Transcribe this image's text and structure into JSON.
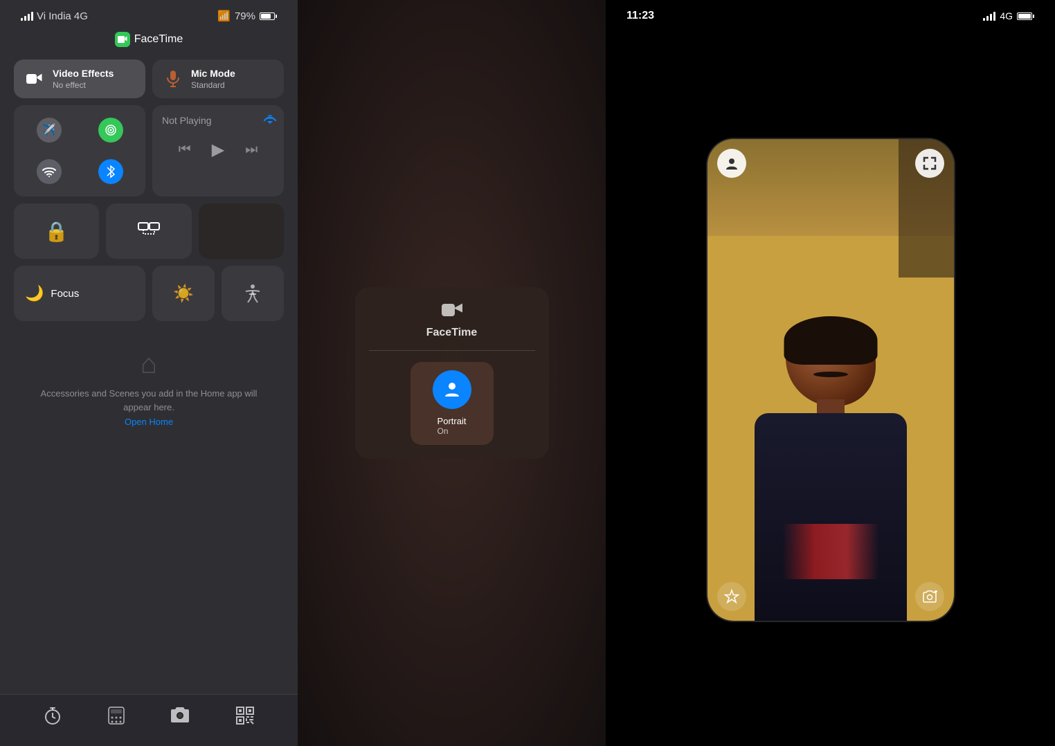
{
  "panels": {
    "left": {
      "status": {
        "carrier": "Vi India 4G",
        "battery": "79%",
        "time": ""
      },
      "app_header": "FaceTime",
      "controls": {
        "video_effects": {
          "label": "Video Effects",
          "sublabel": "No effect"
        },
        "mic_mode": {
          "label": "Mic Mode",
          "sublabel": "Standard"
        },
        "network": {
          "airplane": "Airplane",
          "cellular": "Cellular",
          "wifi": "Wi-Fi",
          "bluetooth": "Bluetooth"
        },
        "music": {
          "not_playing": "Not Playing"
        },
        "lock_rotation": "Lock Rotation",
        "screen_mirror": "Screen Mirror",
        "focus": {
          "label": "Focus",
          "mode": "Focus"
        },
        "brightness": "Brightness"
      },
      "home": {
        "title": "Accessories and Scenes you add in the Home app will appear here.",
        "link": "Open Home"
      },
      "dock": {
        "timer": "Timer",
        "calculator": "Calculator",
        "camera": "Camera",
        "qr": "QR"
      }
    },
    "middle": {
      "popup": {
        "title": "FaceTime",
        "effect": {
          "label": "Portrait",
          "state": "On"
        }
      }
    },
    "right": {
      "status": {
        "time": "11:23",
        "signal": "4G",
        "battery": "full"
      },
      "facetime": {
        "caller_icon": "👤",
        "minimize_icon": "⤡",
        "star_icon": "☆",
        "camera_flip_icon": "📷"
      }
    }
  }
}
